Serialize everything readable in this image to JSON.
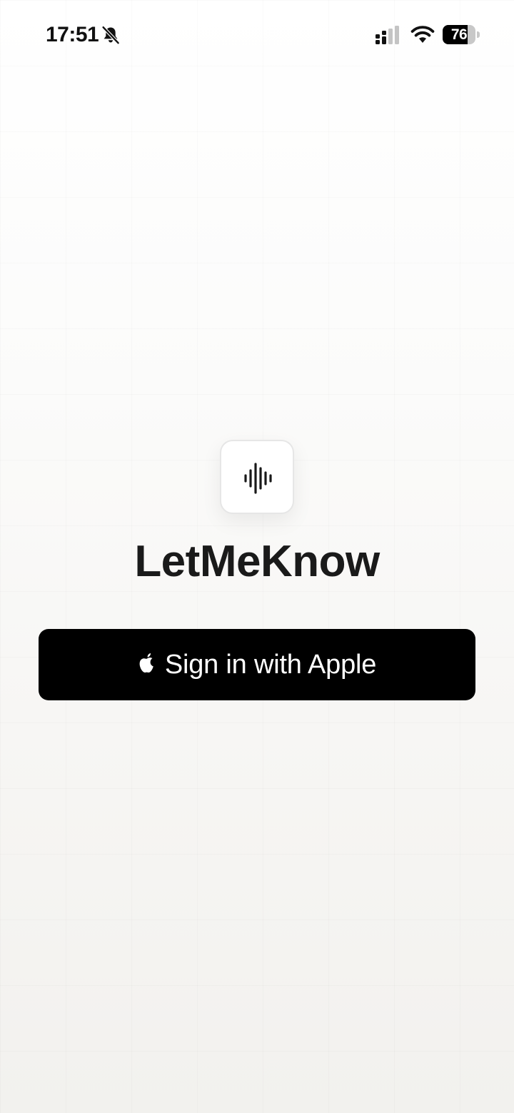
{
  "status_bar": {
    "time": "17:51",
    "battery_level": 76,
    "battery_label": "76",
    "icons": [
      "bell-slash-icon",
      "signal-icon",
      "wifi-icon",
      "battery-icon"
    ]
  },
  "app": {
    "icon": "waveform-icon",
    "title": "LetMeKnow"
  },
  "sign_in": {
    "label": "Sign in with Apple",
    "icon": "apple-logo-icon"
  },
  "colors": {
    "button_background": "#000000",
    "button_text": "#ffffff",
    "title_text": "#1a1a1a",
    "icon_tile_background": "#ffffff"
  }
}
